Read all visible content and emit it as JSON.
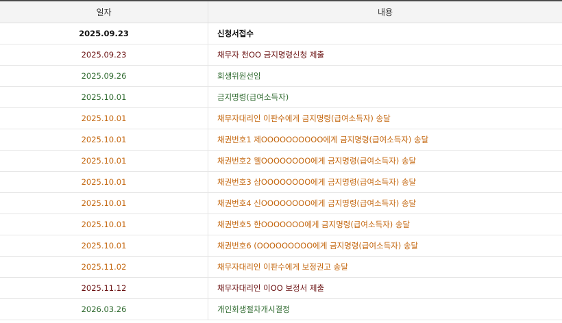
{
  "header": {
    "date_label": "일자",
    "content_label": "내용"
  },
  "colors": {
    "black": "#111111",
    "maroon": "#6b1212",
    "green": "#2f6a2f",
    "orange": "#c4670f"
  },
  "rows": [
    {
      "date": "2025.09.23",
      "content": "신청서접수",
      "color": "#111111",
      "bold": true
    },
    {
      "date": "2025.09.23",
      "content": "채무자 천OO 금지명령신청 제출",
      "color": "#6b1212",
      "bold": false
    },
    {
      "date": "2025.09.26",
      "content": "회생위원선임",
      "color": "#2f6a2f",
      "bold": false
    },
    {
      "date": "2025.10.01",
      "content": "금지명령(급여소득자)",
      "color": "#2f6a2f",
      "bold": false
    },
    {
      "date": "2025.10.01",
      "content": "채무자대리인 이판수에게 금지명령(급여소득자) 송달",
      "color": "#c4670f",
      "bold": false
    },
    {
      "date": "2025.10.01",
      "content": "채권번호1 제OOOOOOOOOO에게 금지명령(급여소득자) 송달",
      "color": "#c4670f",
      "bold": false
    },
    {
      "date": "2025.10.01",
      "content": "채권번호2 웰OOOOOOOO에게 금지명령(급여소득자) 송달",
      "color": "#c4670f",
      "bold": false
    },
    {
      "date": "2025.10.01",
      "content": "채권번호3 삼OOOOOOOO에게 금지명령(급여소득자) 송달",
      "color": "#c4670f",
      "bold": false
    },
    {
      "date": "2025.10.01",
      "content": "채권번호4 신OOOOOOOO에게 금지명령(급여소득자) 송달",
      "color": "#c4670f",
      "bold": false
    },
    {
      "date": "2025.10.01",
      "content": "채권번호5 한OOOOOOO에게 금지명령(급여소득자) 송달",
      "color": "#c4670f",
      "bold": false
    },
    {
      "date": "2025.10.01",
      "content": "채권번호6 (OOOOOOOOO에게 금지명령(급여소득자) 송달",
      "color": "#c4670f",
      "bold": false
    },
    {
      "date": "2025.11.02",
      "content": "채무자대리인 이판수에게 보정권고 송달",
      "color": "#c4670f",
      "bold": false
    },
    {
      "date": "2025.11.12",
      "content": "채무자대리인 이OO 보정서 제출",
      "color": "#6b1212",
      "bold": false
    },
    {
      "date": "2026.03.26",
      "content": "개인회생절차개시결정",
      "color": "#2f6a2f",
      "bold": false
    }
  ]
}
